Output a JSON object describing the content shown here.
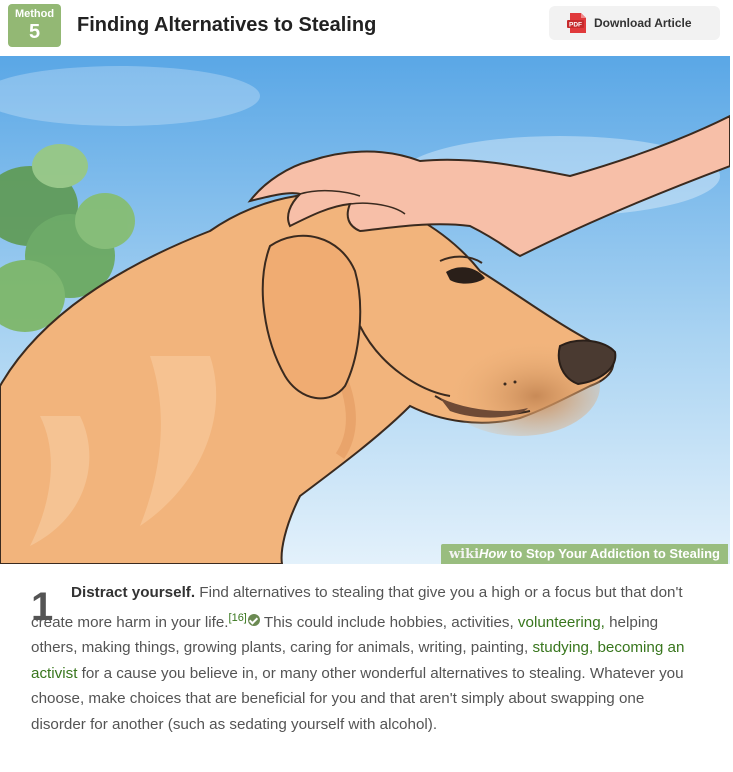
{
  "header": {
    "method_label": "Method",
    "method_number": "5",
    "title": "Finding Alternatives to Stealing",
    "download_label": "Download Article",
    "pdf_icon_text": "PDF"
  },
  "image": {
    "watermark_wiki": "wiki",
    "watermark_how": "How",
    "watermark_rest": " to Stop Your Addiction to Stealing"
  },
  "step": {
    "number": "1",
    "bold_lead": "Distract yourself.",
    "t1": " Find alternatives to stealing that give you a high or a focus but that don't create more harm in your life.",
    "ref": "[16]",
    "t2": " This could include hobbies, activities, ",
    "link_volunteering": "volunteering,",
    "t3": " helping others, making things, growing plants, caring for animals, writing, painting, ",
    "link_studying": "studying,",
    "t4": " ",
    "link_activist": "becoming an activist",
    "t5": " for a cause you believe in, or many other wonderful alternatives to stealing. Whatever you choose, make choices that are beneficial for you and that aren't simply about swapping one disorder for another (such as sedating yourself with alcohol)."
  },
  "colors": {
    "accent_green": "#93b874",
    "link_green": "#38761d",
    "pdf_red": "#e0393b"
  },
  "icons": [
    "pdf-icon",
    "expert-check-icon"
  ]
}
